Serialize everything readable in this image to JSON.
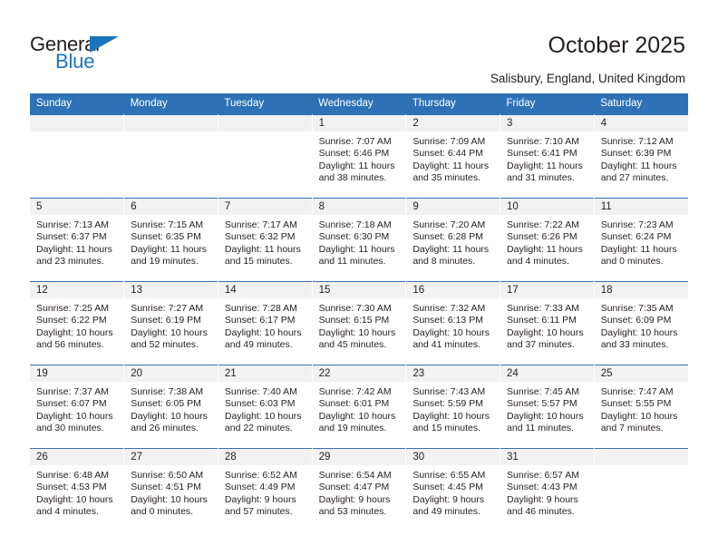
{
  "brand": {
    "name_part1": "General",
    "name_part2": "Blue",
    "flag_icon": "triangle-flag-icon",
    "accent_color": "#1b75bb"
  },
  "header": {
    "title": "October 2025",
    "location": "Salisbury, England, United Kingdom"
  },
  "theme": {
    "header_bg": "#2e72b5",
    "daynum_band_bg": "#f2f2f2",
    "text_color": "#231f20"
  },
  "calendar": {
    "weekday_headers": [
      "Sunday",
      "Monday",
      "Tuesday",
      "Wednesday",
      "Thursday",
      "Friday",
      "Saturday"
    ],
    "weeks": [
      [
        {
          "day": "",
          "blank": true
        },
        {
          "day": "",
          "blank": true
        },
        {
          "day": "",
          "blank": true
        },
        {
          "day": "1",
          "sunrise": "Sunrise: 7:07 AM",
          "sunset": "Sunset: 6:46 PM",
          "daylight_line1": "Daylight: 11 hours",
          "daylight_line2": "and 38 minutes."
        },
        {
          "day": "2",
          "sunrise": "Sunrise: 7:09 AM",
          "sunset": "Sunset: 6:44 PM",
          "daylight_line1": "Daylight: 11 hours",
          "daylight_line2": "and 35 minutes."
        },
        {
          "day": "3",
          "sunrise": "Sunrise: 7:10 AM",
          "sunset": "Sunset: 6:41 PM",
          "daylight_line1": "Daylight: 11 hours",
          "daylight_line2": "and 31 minutes."
        },
        {
          "day": "4",
          "sunrise": "Sunrise: 7:12 AM",
          "sunset": "Sunset: 6:39 PM",
          "daylight_line1": "Daylight: 11 hours",
          "daylight_line2": "and 27 minutes."
        }
      ],
      [
        {
          "day": "5",
          "sunrise": "Sunrise: 7:13 AM",
          "sunset": "Sunset: 6:37 PM",
          "daylight_line1": "Daylight: 11 hours",
          "daylight_line2": "and 23 minutes."
        },
        {
          "day": "6",
          "sunrise": "Sunrise: 7:15 AM",
          "sunset": "Sunset: 6:35 PM",
          "daylight_line1": "Daylight: 11 hours",
          "daylight_line2": "and 19 minutes."
        },
        {
          "day": "7",
          "sunrise": "Sunrise: 7:17 AM",
          "sunset": "Sunset: 6:32 PM",
          "daylight_line1": "Daylight: 11 hours",
          "daylight_line2": "and 15 minutes."
        },
        {
          "day": "8",
          "sunrise": "Sunrise: 7:18 AM",
          "sunset": "Sunset: 6:30 PM",
          "daylight_line1": "Daylight: 11 hours",
          "daylight_line2": "and 11 minutes."
        },
        {
          "day": "9",
          "sunrise": "Sunrise: 7:20 AM",
          "sunset": "Sunset: 6:28 PM",
          "daylight_line1": "Daylight: 11 hours",
          "daylight_line2": "and 8 minutes."
        },
        {
          "day": "10",
          "sunrise": "Sunrise: 7:22 AM",
          "sunset": "Sunset: 6:26 PM",
          "daylight_line1": "Daylight: 11 hours",
          "daylight_line2": "and 4 minutes."
        },
        {
          "day": "11",
          "sunrise": "Sunrise: 7:23 AM",
          "sunset": "Sunset: 6:24 PM",
          "daylight_line1": "Daylight: 11 hours",
          "daylight_line2": "and 0 minutes."
        }
      ],
      [
        {
          "day": "12",
          "sunrise": "Sunrise: 7:25 AM",
          "sunset": "Sunset: 6:22 PM",
          "daylight_line1": "Daylight: 10 hours",
          "daylight_line2": "and 56 minutes."
        },
        {
          "day": "13",
          "sunrise": "Sunrise: 7:27 AM",
          "sunset": "Sunset: 6:19 PM",
          "daylight_line1": "Daylight: 10 hours",
          "daylight_line2": "and 52 minutes."
        },
        {
          "day": "14",
          "sunrise": "Sunrise: 7:28 AM",
          "sunset": "Sunset: 6:17 PM",
          "daylight_line1": "Daylight: 10 hours",
          "daylight_line2": "and 49 minutes."
        },
        {
          "day": "15",
          "sunrise": "Sunrise: 7:30 AM",
          "sunset": "Sunset: 6:15 PM",
          "daylight_line1": "Daylight: 10 hours",
          "daylight_line2": "and 45 minutes."
        },
        {
          "day": "16",
          "sunrise": "Sunrise: 7:32 AM",
          "sunset": "Sunset: 6:13 PM",
          "daylight_line1": "Daylight: 10 hours",
          "daylight_line2": "and 41 minutes."
        },
        {
          "day": "17",
          "sunrise": "Sunrise: 7:33 AM",
          "sunset": "Sunset: 6:11 PM",
          "daylight_line1": "Daylight: 10 hours",
          "daylight_line2": "and 37 minutes."
        },
        {
          "day": "18",
          "sunrise": "Sunrise: 7:35 AM",
          "sunset": "Sunset: 6:09 PM",
          "daylight_line1": "Daylight: 10 hours",
          "daylight_line2": "and 33 minutes."
        }
      ],
      [
        {
          "day": "19",
          "sunrise": "Sunrise: 7:37 AM",
          "sunset": "Sunset: 6:07 PM",
          "daylight_line1": "Daylight: 10 hours",
          "daylight_line2": "and 30 minutes."
        },
        {
          "day": "20",
          "sunrise": "Sunrise: 7:38 AM",
          "sunset": "Sunset: 6:05 PM",
          "daylight_line1": "Daylight: 10 hours",
          "daylight_line2": "and 26 minutes."
        },
        {
          "day": "21",
          "sunrise": "Sunrise: 7:40 AM",
          "sunset": "Sunset: 6:03 PM",
          "daylight_line1": "Daylight: 10 hours",
          "daylight_line2": "and 22 minutes."
        },
        {
          "day": "22",
          "sunrise": "Sunrise: 7:42 AM",
          "sunset": "Sunset: 6:01 PM",
          "daylight_line1": "Daylight: 10 hours",
          "daylight_line2": "and 19 minutes."
        },
        {
          "day": "23",
          "sunrise": "Sunrise: 7:43 AM",
          "sunset": "Sunset: 5:59 PM",
          "daylight_line1": "Daylight: 10 hours",
          "daylight_line2": "and 15 minutes."
        },
        {
          "day": "24",
          "sunrise": "Sunrise: 7:45 AM",
          "sunset": "Sunset: 5:57 PM",
          "daylight_line1": "Daylight: 10 hours",
          "daylight_line2": "and 11 minutes."
        },
        {
          "day": "25",
          "sunrise": "Sunrise: 7:47 AM",
          "sunset": "Sunset: 5:55 PM",
          "daylight_line1": "Daylight: 10 hours",
          "daylight_line2": "and 7 minutes."
        }
      ],
      [
        {
          "day": "26",
          "sunrise": "Sunrise: 6:48 AM",
          "sunset": "Sunset: 4:53 PM",
          "daylight_line1": "Daylight: 10 hours",
          "daylight_line2": "and 4 minutes."
        },
        {
          "day": "27",
          "sunrise": "Sunrise: 6:50 AM",
          "sunset": "Sunset: 4:51 PM",
          "daylight_line1": "Daylight: 10 hours",
          "daylight_line2": "and 0 minutes."
        },
        {
          "day": "28",
          "sunrise": "Sunrise: 6:52 AM",
          "sunset": "Sunset: 4:49 PM",
          "daylight_line1": "Daylight: 9 hours",
          "daylight_line2": "and 57 minutes."
        },
        {
          "day": "29",
          "sunrise": "Sunrise: 6:54 AM",
          "sunset": "Sunset: 4:47 PM",
          "daylight_line1": "Daylight: 9 hours",
          "daylight_line2": "and 53 minutes."
        },
        {
          "day": "30",
          "sunrise": "Sunrise: 6:55 AM",
          "sunset": "Sunset: 4:45 PM",
          "daylight_line1": "Daylight: 9 hours",
          "daylight_line2": "and 49 minutes."
        },
        {
          "day": "31",
          "sunrise": "Sunrise: 6:57 AM",
          "sunset": "Sunset: 4:43 PM",
          "daylight_line1": "Daylight: 9 hours",
          "daylight_line2": "and 46 minutes."
        },
        {
          "day": "",
          "blank": true
        }
      ]
    ]
  }
}
